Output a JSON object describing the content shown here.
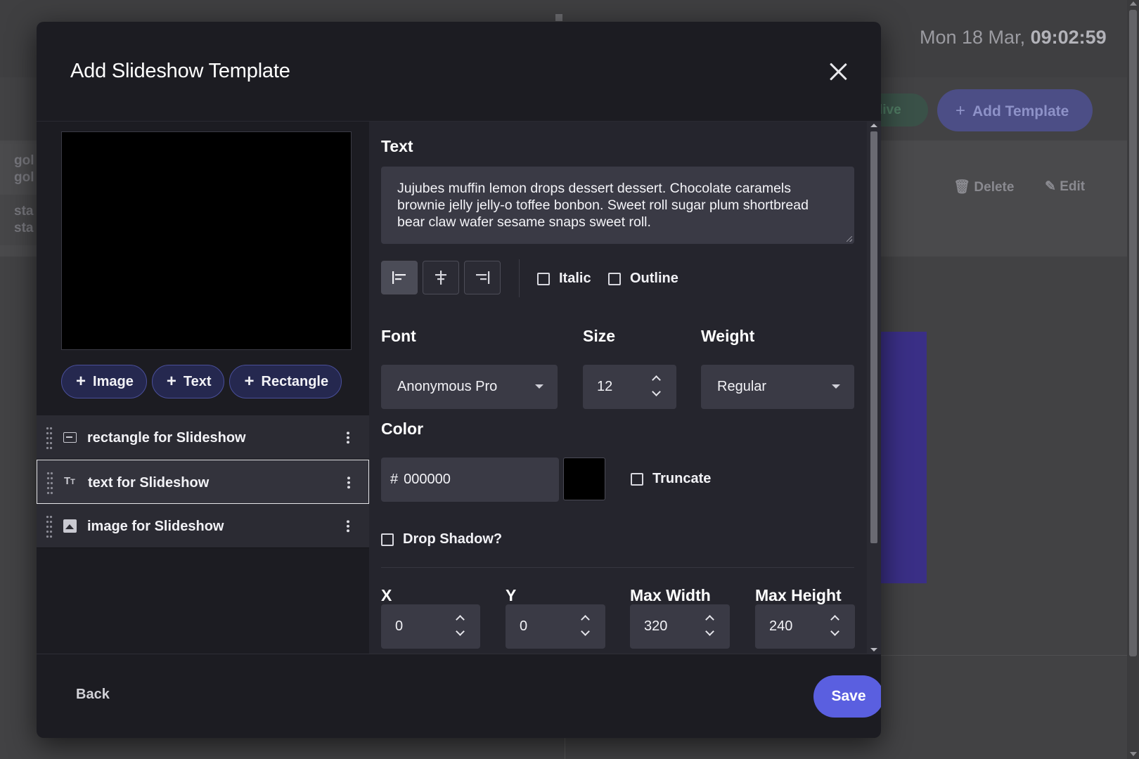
{
  "background": {
    "clock": {
      "date": "Mon 18 Mar,",
      "time": "09:02:59"
    },
    "live_label": "live",
    "add_template_label": "Add Template",
    "delete_label": "Delete",
    "edit_label": "Edit",
    "side_items": [
      {
        "line1": "gol",
        "line2": "gol"
      },
      {
        "line1": "sta",
        "line2": "sta"
      }
    ]
  },
  "modal": {
    "title": "Add Slideshow Template",
    "add_buttons": {
      "image": "Image",
      "text": "Text",
      "rectangle": "Rectangle"
    },
    "layers": [
      {
        "name": "rectangle for Slideshow",
        "icon": "rectangle-icon",
        "active": false
      },
      {
        "name": "text for Slideshow",
        "icon": "text-type-icon",
        "active": true
      },
      {
        "name": "image for Slideshow",
        "icon": "image-icon",
        "active": false
      }
    ],
    "text_section": {
      "label": "Text",
      "value": "Jujubes muffin lemon drops dessert dessert. Chocolate caramels brownie jelly jelly-o toffee bonbon. Sweet roll sugar plum shortbread bear claw wafer sesame snaps sweet roll."
    },
    "align": {
      "selected": "left",
      "options": [
        "left",
        "center",
        "right"
      ]
    },
    "italic": {
      "label": "Italic",
      "checked": false
    },
    "outline": {
      "label": "Outline",
      "checked": false
    },
    "font": {
      "label": "Font",
      "value": "Anonymous Pro"
    },
    "size": {
      "label": "Size",
      "value": "12"
    },
    "weight": {
      "label": "Weight",
      "value": "Regular"
    },
    "color": {
      "label": "Color",
      "hash": "#",
      "value": "000000",
      "swatch": "#000000"
    },
    "truncate": {
      "label": "Truncate",
      "checked": false
    },
    "drop_shadow": {
      "label": "Drop Shadow?",
      "checked": false
    },
    "position": {
      "x": {
        "label": "X",
        "value": "0"
      },
      "y": {
        "label": "Y",
        "value": "0"
      },
      "max_width": {
        "label": "Max Width",
        "value": "320"
      },
      "max_height": {
        "label": "Max Height",
        "value": "240"
      }
    },
    "footer": {
      "back": "Back",
      "save": "Save"
    }
  },
  "colors": {
    "accent": "#5a5fe0",
    "modal_bg": "#1c1c22",
    "panel_bg": "#25252d",
    "input_bg": "#3a3a45"
  }
}
